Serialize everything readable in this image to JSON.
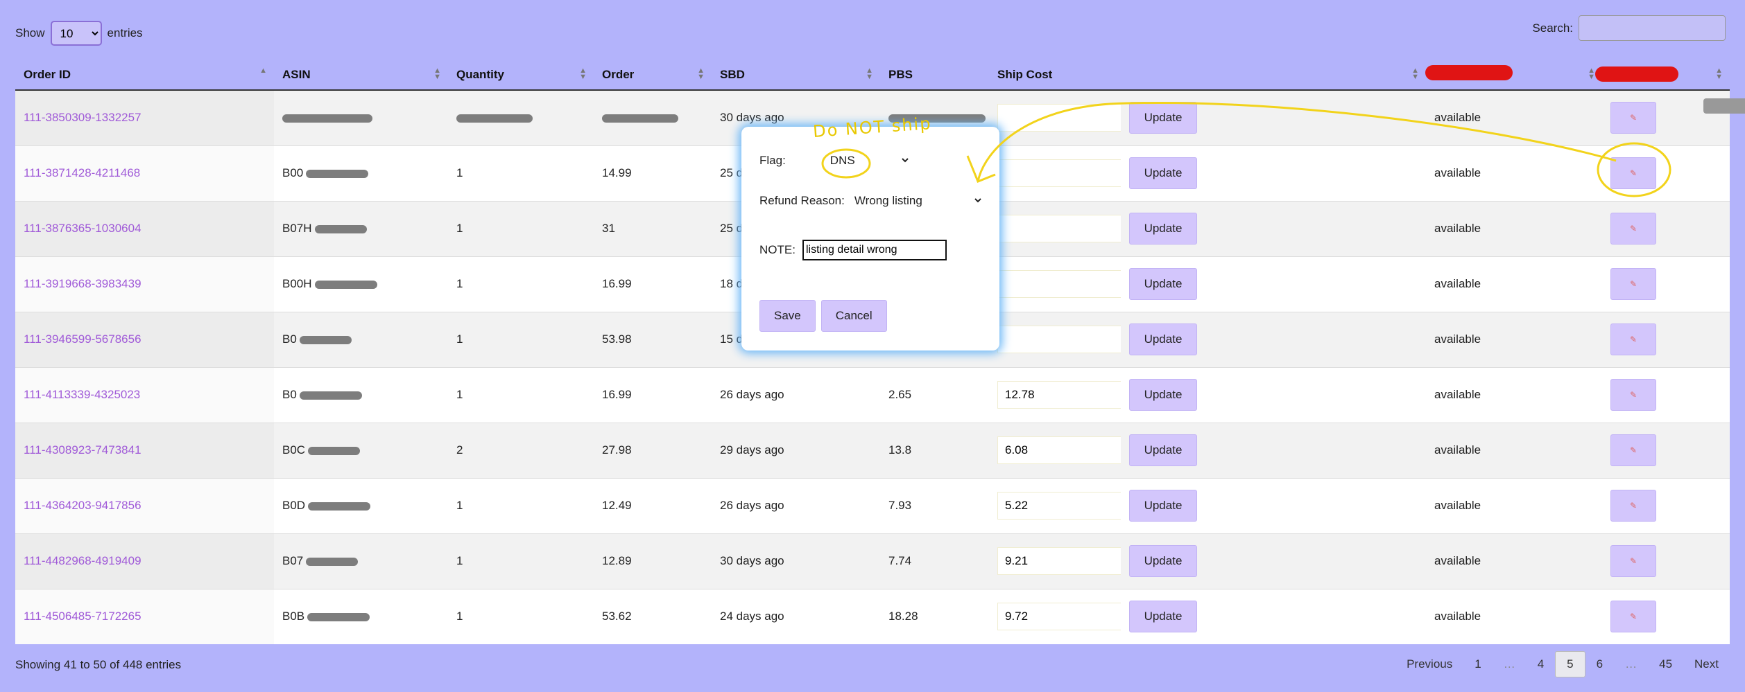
{
  "length_menu": {
    "prefix": "Show",
    "value": "10",
    "options": [
      "10"
    ],
    "suffix": "entries"
  },
  "search": {
    "label": "Search:",
    "value": ""
  },
  "columns": [
    "Order ID",
    "ASIN",
    "Quantity",
    "Order",
    "SBD",
    "PBS",
    "Ship Cost"
  ],
  "rows": [
    {
      "order_id": "111-3850309-1332257",
      "asin": "",
      "qty": "",
      "order": "",
      "sbd": "30 days ago",
      "pbs": "",
      "ship_cost": "",
      "status": "available"
    },
    {
      "order_id": "111-3871428-4211468",
      "asin": "B00",
      "qty": "1",
      "order": "14.99",
      "sbd": "25 days ago",
      "pbs": "",
      "ship_cost": "",
      "status": "available"
    },
    {
      "order_id": "111-3876365-1030604",
      "asin": "B07H",
      "qty": "1",
      "order": "31",
      "sbd": "25 days ago",
      "pbs": "",
      "ship_cost": "",
      "status": "available"
    },
    {
      "order_id": "111-3919668-3983439",
      "asin": "B00H",
      "qty": "1",
      "order": "16.99",
      "sbd": "18 days ago",
      "pbs": "",
      "ship_cost": "",
      "status": "available"
    },
    {
      "order_id": "111-3946599-5678656",
      "asin": "B0",
      "qty": "1",
      "order": "53.98",
      "sbd": "15 days ago",
      "pbs": "",
      "ship_cost": "",
      "status": "available"
    },
    {
      "order_id": "111-4113339-4325023",
      "asin": "B0",
      "qty": "1",
      "order": "16.99",
      "sbd": "26 days ago",
      "pbs": "2.65",
      "ship_cost": "12.78",
      "status": "available"
    },
    {
      "order_id": "111-4308923-7473841",
      "asin": "B0C",
      "qty": "2",
      "order": "27.98",
      "sbd": "29 days ago",
      "pbs": "13.8",
      "ship_cost": "6.08",
      "status": "available"
    },
    {
      "order_id": "111-4364203-9417856",
      "asin": "B0D",
      "qty": "1",
      "order": "12.49",
      "sbd": "26 days ago",
      "pbs": "7.93",
      "ship_cost": "5.22",
      "status": "available"
    },
    {
      "order_id": "111-4482968-4919409",
      "asin": "B07",
      "qty": "1",
      "order": "12.89",
      "sbd": "30 days ago",
      "pbs": "7.74",
      "ship_cost": "9.21",
      "status": "available"
    },
    {
      "order_id": "111-4506485-7172265",
      "asin": "B0B",
      "qty": "1",
      "order": "53.62",
      "sbd": "24 days ago",
      "pbs": "18.28",
      "ship_cost": "9.72",
      "status": "available"
    }
  ],
  "update_label": "Update",
  "footer": {
    "info": "Showing 41 to 50 of 448 entries"
  },
  "pager": {
    "previous": "Previous",
    "pages": [
      "1",
      "…",
      "4",
      "5",
      "6",
      "…",
      "45"
    ],
    "current": "5",
    "next": "Next"
  },
  "modal": {
    "flag_label": "Flag:",
    "flag_value": "DNS",
    "refund_label": "Refund Reason:",
    "refund_value": "Wrong listing",
    "note_label": "NOTE:",
    "note_value": "listing detail wrong",
    "save": "Save",
    "cancel": "Cancel"
  },
  "annotation": {
    "text": "Do NOT ship",
    "color": "#f2d31b"
  },
  "colors": {
    "background": "#b3b3fb",
    "button": "#d3c6fc",
    "link": "#a05ad8",
    "modal_glow": "#69b6f7"
  }
}
